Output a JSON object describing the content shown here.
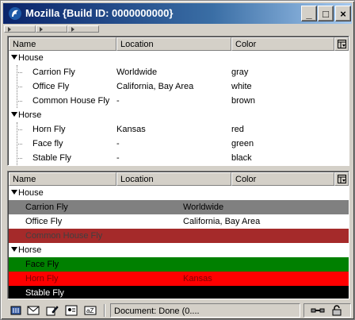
{
  "window": {
    "title": "Mozilla {Build ID: 0000000000}"
  },
  "icons": {
    "app": "mozilla-icon",
    "minimize": "minimize-icon",
    "maximize": "maximize-icon",
    "close": "close-icon",
    "column_picker": "column-picker-icon",
    "twisty": "twisty-open-icon"
  },
  "title_buttons": {
    "minimize": "_",
    "maximize": "□",
    "close": "×"
  },
  "top_tree": {
    "columns": [
      "Name",
      "Location",
      "Color"
    ],
    "groups": [
      {
        "label": "House",
        "rows": [
          {
            "name": "Carrion Fly",
            "location": "Worldwide",
            "color": "gray"
          },
          {
            "name": "Office Fly",
            "location": "California, Bay Area",
            "color": "white"
          },
          {
            "name": "Common House Fly",
            "location": "-",
            "color": "brown"
          }
        ]
      },
      {
        "label": "Horse",
        "rows": [
          {
            "name": "Horn Fly",
            "location": "Kansas",
            "color": "red"
          },
          {
            "name": "Face fly",
            "location": "-",
            "color": "green"
          },
          {
            "name": "Stable Fly",
            "location": "-",
            "color": "black"
          }
        ]
      }
    ]
  },
  "bottom_tree": {
    "columns": [
      "Name",
      "Location",
      "Color"
    ],
    "groups": [
      {
        "label": "House",
        "rows": [
          {
            "name": "Carrion Fly",
            "location": "Worldwide",
            "bg": "#808080",
            "fg": "#000000"
          },
          {
            "name": "Office Fly",
            "location": "California, Bay Area",
            "bg": "#ffffff",
            "fg": "#000000"
          },
          {
            "name": "Common House Fly",
            "location": "",
            "bg": "#a52a2a",
            "fg": "#404040"
          }
        ]
      },
      {
        "label": "Horse",
        "rows": [
          {
            "name": "Face Fly",
            "location": "",
            "bg": "#008000",
            "fg": "#000000"
          },
          {
            "name": "Horn Fly",
            "location": "Kansas",
            "bg": "#ff0000",
            "fg": "#800000"
          },
          {
            "name": "Stable Fly",
            "location": "",
            "bg": "#000000",
            "fg": "#ffffff"
          }
        ]
      }
    ]
  },
  "statusbar": {
    "text": "Document: Done (0....",
    "icons": [
      "navigator-icon",
      "mail-icon",
      "composer-icon",
      "addressbook-icon",
      "chat-icon"
    ],
    "right_icons": [
      "online-connection-icon",
      "security-lock-icon"
    ]
  },
  "colors": {
    "titlebar_start": "#0a246a",
    "titlebar_end": "#a6caf0",
    "chrome": "#d4d0c8"
  }
}
